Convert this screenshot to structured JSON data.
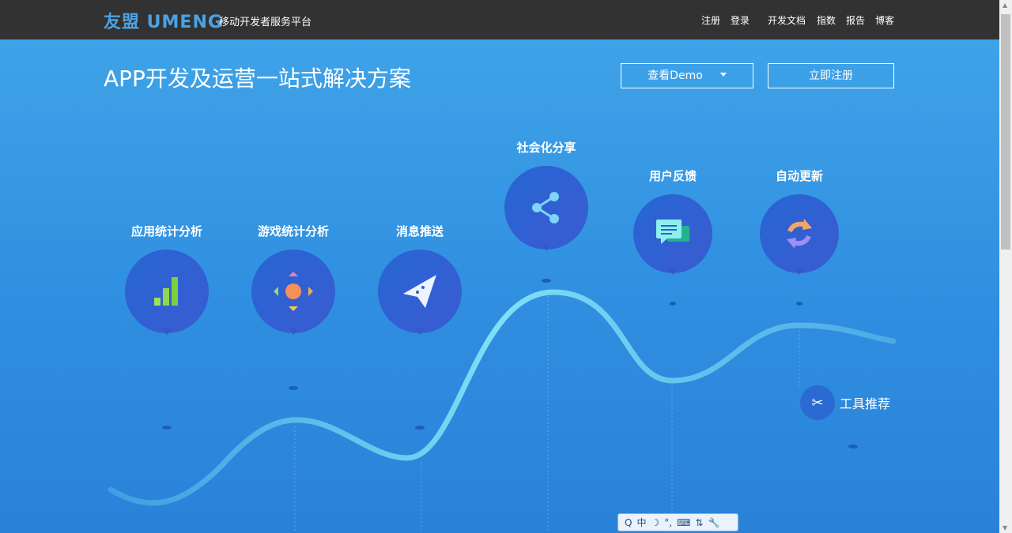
{
  "header": {
    "logo": "友盟 UMENG",
    "subtitle": "移动开发者服务平台",
    "nav": [
      "注册",
      "登录",
      "开发文档",
      "指数",
      "报告",
      "博客"
    ]
  },
  "hero": {
    "title": "APP开发及运营一站式解决方案",
    "demo_button": "查看Demo",
    "register_button": "立即注册",
    "features": [
      {
        "label": "应用统计分析",
        "icon": "bar-chart-icon"
      },
      {
        "label": "游戏统计分析",
        "icon": "gamepad-icon"
      },
      {
        "label": "消息推送",
        "icon": "paper-plane-icon"
      },
      {
        "label": "社会化分享",
        "icon": "share-icon"
      },
      {
        "label": "用户反馈",
        "icon": "chat-icon"
      },
      {
        "label": "自动更新",
        "icon": "refresh-icon"
      }
    ],
    "tools": "工具推荐"
  },
  "ime": [
    "Q",
    "中",
    "☽",
    "°,",
    "⌨",
    "⇅",
    "🔧"
  ]
}
